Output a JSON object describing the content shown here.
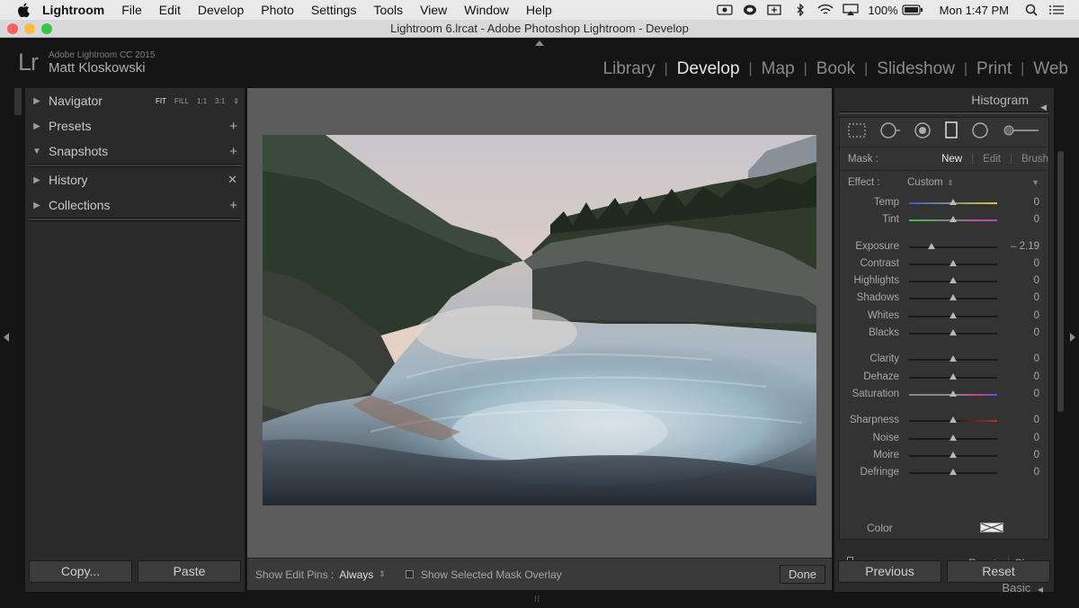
{
  "menubar": {
    "app": "Lightroom",
    "items": [
      "File",
      "Edit",
      "Develop",
      "Photo",
      "Settings",
      "Tools",
      "View",
      "Window",
      "Help"
    ],
    "battery": "100%",
    "clock": "Mon 1:47 PM"
  },
  "window": {
    "title": "Lightroom 6.lrcat - Adobe Photoshop Lightroom - Develop"
  },
  "identity": {
    "logo": "Lr",
    "product": "Adobe Lightroom CC 2015",
    "user": "Matt Kloskowski"
  },
  "modules": [
    "Library",
    "Develop",
    "Map",
    "Book",
    "Slideshow",
    "Print",
    "Web"
  ],
  "active_module": "Develop",
  "left_panel": {
    "navigator": {
      "label": "Navigator",
      "zoom": [
        "FIT",
        "FILL",
        "1:1",
        "3:1"
      ]
    },
    "presets": "Presets",
    "snapshots": "Snapshots",
    "history": "History",
    "collections": "Collections",
    "copy_button": "Copy...",
    "paste_button": "Paste"
  },
  "right_panel": {
    "histogram_label": "Histogram",
    "mask_label": "Mask :",
    "mask_options": [
      "New",
      "Edit",
      "Brush"
    ],
    "effect_label": "Effect :",
    "effect_value": "Custom",
    "groups": [
      [
        {
          "label": "Temp",
          "value": "0",
          "pos": 0.5
        },
        {
          "label": "Tint",
          "value": "0",
          "pos": 0.5
        }
      ],
      [
        {
          "label": "Exposure",
          "value": "– 2.19",
          "pos": 0.25
        },
        {
          "label": "Contrast",
          "value": "0",
          "pos": 0.5
        },
        {
          "label": "Highlights",
          "value": "0",
          "pos": 0.5
        },
        {
          "label": "Shadows",
          "value": "0",
          "pos": 0.5
        },
        {
          "label": "Whites",
          "value": "0",
          "pos": 0.5
        },
        {
          "label": "Blacks",
          "value": "0",
          "pos": 0.5
        }
      ],
      [
        {
          "label": "Clarity",
          "value": "0",
          "pos": 0.5
        },
        {
          "label": "Dehaze",
          "value": "0",
          "pos": 0.5
        },
        {
          "label": "Saturation",
          "value": "0",
          "pos": 0.5
        }
      ],
      [
        {
          "label": "Sharpness",
          "value": "0",
          "pos": 0.5
        },
        {
          "label": "Noise",
          "value": "0",
          "pos": 0.5
        },
        {
          "label": "Moire",
          "value": "0",
          "pos": 0.5
        },
        {
          "label": "Defringe",
          "value": "0",
          "pos": 0.5
        }
      ]
    ],
    "color_label": "Color",
    "reset_label": "Reset",
    "close_label": "Close",
    "basic_label": "Basic",
    "previous_button": "Previous",
    "reset_button": "Reset"
  },
  "toolbar": {
    "edit_pins_label": "Show Edit Pins :",
    "edit_pins_value": "Always",
    "overlay_label": "Show Selected Mask Overlay",
    "done_button": "Done"
  }
}
